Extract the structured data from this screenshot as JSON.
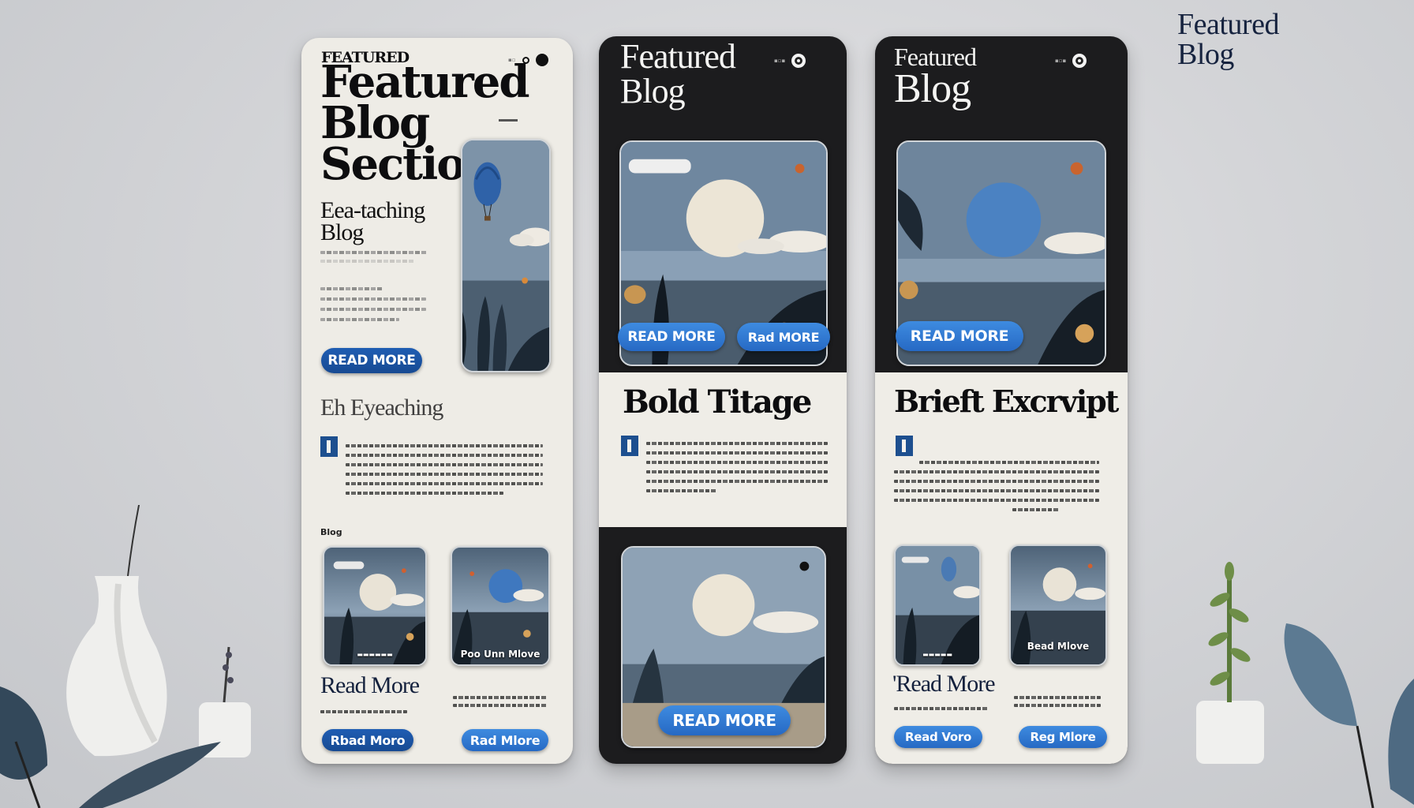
{
  "corner_title": {
    "line1": "Featured",
    "line2": "Blog"
  },
  "card1": {
    "eyebrow": "FEATURED",
    "title_line1": "Featured",
    "title_line2": "Blog",
    "title_line3": "Section",
    "subtitle_line1": "Eea-taching",
    "subtitle_line2": "Blog",
    "read_more": "READ MORE",
    "section_heading": "Eh Eyeaching",
    "blog_label": "Blog",
    "thumb2_caption": "Poo Unn Mlove",
    "read_more_heading": "Read More",
    "btn_left": "Rbad Moro",
    "btn_right": "Rad Mlore"
  },
  "card2": {
    "title_line1": "Featured",
    "title_line2": "Blog",
    "btn_left": "READ MORE",
    "btn_right": "Rad MORE",
    "heading": "Bold Titage",
    "bottom_btn": "READ MORE"
  },
  "card3": {
    "title_line1": "Featured",
    "title_line2": "Blog",
    "btn": "READ MORE",
    "heading": "Brieft Excrvipt",
    "thumb2_caption": "Bead Mlove",
    "read_more_heading": "'Read More",
    "btn_left": "Read Voro",
    "btn_right": "Reg Mlore"
  },
  "colors": {
    "accent": "#2f77d4",
    "dark_card": "#1c1c1e",
    "light_card": "#eeece6",
    "title_navy": "#16233f"
  }
}
